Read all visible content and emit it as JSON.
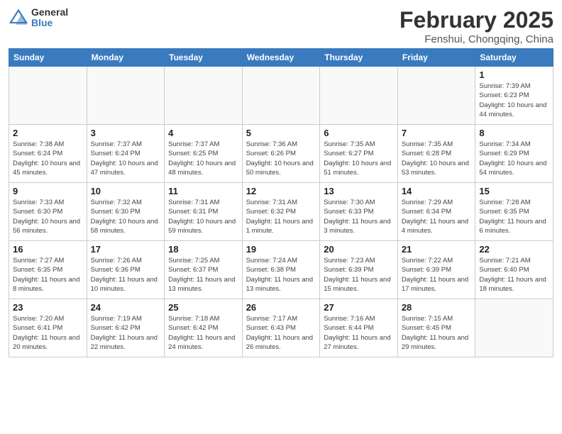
{
  "logo": {
    "general": "General",
    "blue": "Blue"
  },
  "title": "February 2025",
  "subtitle": "Fenshui, Chongqing, China",
  "weekdays": [
    "Sunday",
    "Monday",
    "Tuesday",
    "Wednesday",
    "Thursday",
    "Friday",
    "Saturday"
  ],
  "weeks": [
    [
      {
        "day": "",
        "info": ""
      },
      {
        "day": "",
        "info": ""
      },
      {
        "day": "",
        "info": ""
      },
      {
        "day": "",
        "info": ""
      },
      {
        "day": "",
        "info": ""
      },
      {
        "day": "",
        "info": ""
      },
      {
        "day": "1",
        "info": "Sunrise: 7:39 AM\nSunset: 6:23 PM\nDaylight: 10 hours and 44 minutes."
      }
    ],
    [
      {
        "day": "2",
        "info": "Sunrise: 7:38 AM\nSunset: 6:24 PM\nDaylight: 10 hours and 45 minutes."
      },
      {
        "day": "3",
        "info": "Sunrise: 7:37 AM\nSunset: 6:24 PM\nDaylight: 10 hours and 47 minutes."
      },
      {
        "day": "4",
        "info": "Sunrise: 7:37 AM\nSunset: 6:25 PM\nDaylight: 10 hours and 48 minutes."
      },
      {
        "day": "5",
        "info": "Sunrise: 7:36 AM\nSunset: 6:26 PM\nDaylight: 10 hours and 50 minutes."
      },
      {
        "day": "6",
        "info": "Sunrise: 7:35 AM\nSunset: 6:27 PM\nDaylight: 10 hours and 51 minutes."
      },
      {
        "day": "7",
        "info": "Sunrise: 7:35 AM\nSunset: 6:28 PM\nDaylight: 10 hours and 53 minutes."
      },
      {
        "day": "8",
        "info": "Sunrise: 7:34 AM\nSunset: 6:29 PM\nDaylight: 10 hours and 54 minutes."
      }
    ],
    [
      {
        "day": "9",
        "info": "Sunrise: 7:33 AM\nSunset: 6:30 PM\nDaylight: 10 hours and 56 minutes."
      },
      {
        "day": "10",
        "info": "Sunrise: 7:32 AM\nSunset: 6:30 PM\nDaylight: 10 hours and 58 minutes."
      },
      {
        "day": "11",
        "info": "Sunrise: 7:31 AM\nSunset: 6:31 PM\nDaylight: 10 hours and 59 minutes."
      },
      {
        "day": "12",
        "info": "Sunrise: 7:31 AM\nSunset: 6:32 PM\nDaylight: 11 hours and 1 minute."
      },
      {
        "day": "13",
        "info": "Sunrise: 7:30 AM\nSunset: 6:33 PM\nDaylight: 11 hours and 3 minutes."
      },
      {
        "day": "14",
        "info": "Sunrise: 7:29 AM\nSunset: 6:34 PM\nDaylight: 11 hours and 4 minutes."
      },
      {
        "day": "15",
        "info": "Sunrise: 7:28 AM\nSunset: 6:35 PM\nDaylight: 11 hours and 6 minutes."
      }
    ],
    [
      {
        "day": "16",
        "info": "Sunrise: 7:27 AM\nSunset: 6:35 PM\nDaylight: 11 hours and 8 minutes."
      },
      {
        "day": "17",
        "info": "Sunrise: 7:26 AM\nSunset: 6:36 PM\nDaylight: 11 hours and 10 minutes."
      },
      {
        "day": "18",
        "info": "Sunrise: 7:25 AM\nSunset: 6:37 PM\nDaylight: 11 hours and 13 minutes."
      },
      {
        "day": "19",
        "info": "Sunrise: 7:24 AM\nSunset: 6:38 PM\nDaylight: 11 hours and 13 minutes."
      },
      {
        "day": "20",
        "info": "Sunrise: 7:23 AM\nSunset: 6:39 PM\nDaylight: 11 hours and 15 minutes."
      },
      {
        "day": "21",
        "info": "Sunrise: 7:22 AM\nSunset: 6:39 PM\nDaylight: 11 hours and 17 minutes."
      },
      {
        "day": "22",
        "info": "Sunrise: 7:21 AM\nSunset: 6:40 PM\nDaylight: 11 hours and 18 minutes."
      }
    ],
    [
      {
        "day": "23",
        "info": "Sunrise: 7:20 AM\nSunset: 6:41 PM\nDaylight: 11 hours and 20 minutes."
      },
      {
        "day": "24",
        "info": "Sunrise: 7:19 AM\nSunset: 6:42 PM\nDaylight: 11 hours and 22 minutes."
      },
      {
        "day": "25",
        "info": "Sunrise: 7:18 AM\nSunset: 6:42 PM\nDaylight: 11 hours and 24 minutes."
      },
      {
        "day": "26",
        "info": "Sunrise: 7:17 AM\nSunset: 6:43 PM\nDaylight: 11 hours and 26 minutes."
      },
      {
        "day": "27",
        "info": "Sunrise: 7:16 AM\nSunset: 6:44 PM\nDaylight: 11 hours and 27 minutes."
      },
      {
        "day": "28",
        "info": "Sunrise: 7:15 AM\nSunset: 6:45 PM\nDaylight: 11 hours and 29 minutes."
      },
      {
        "day": "",
        "info": ""
      }
    ]
  ]
}
